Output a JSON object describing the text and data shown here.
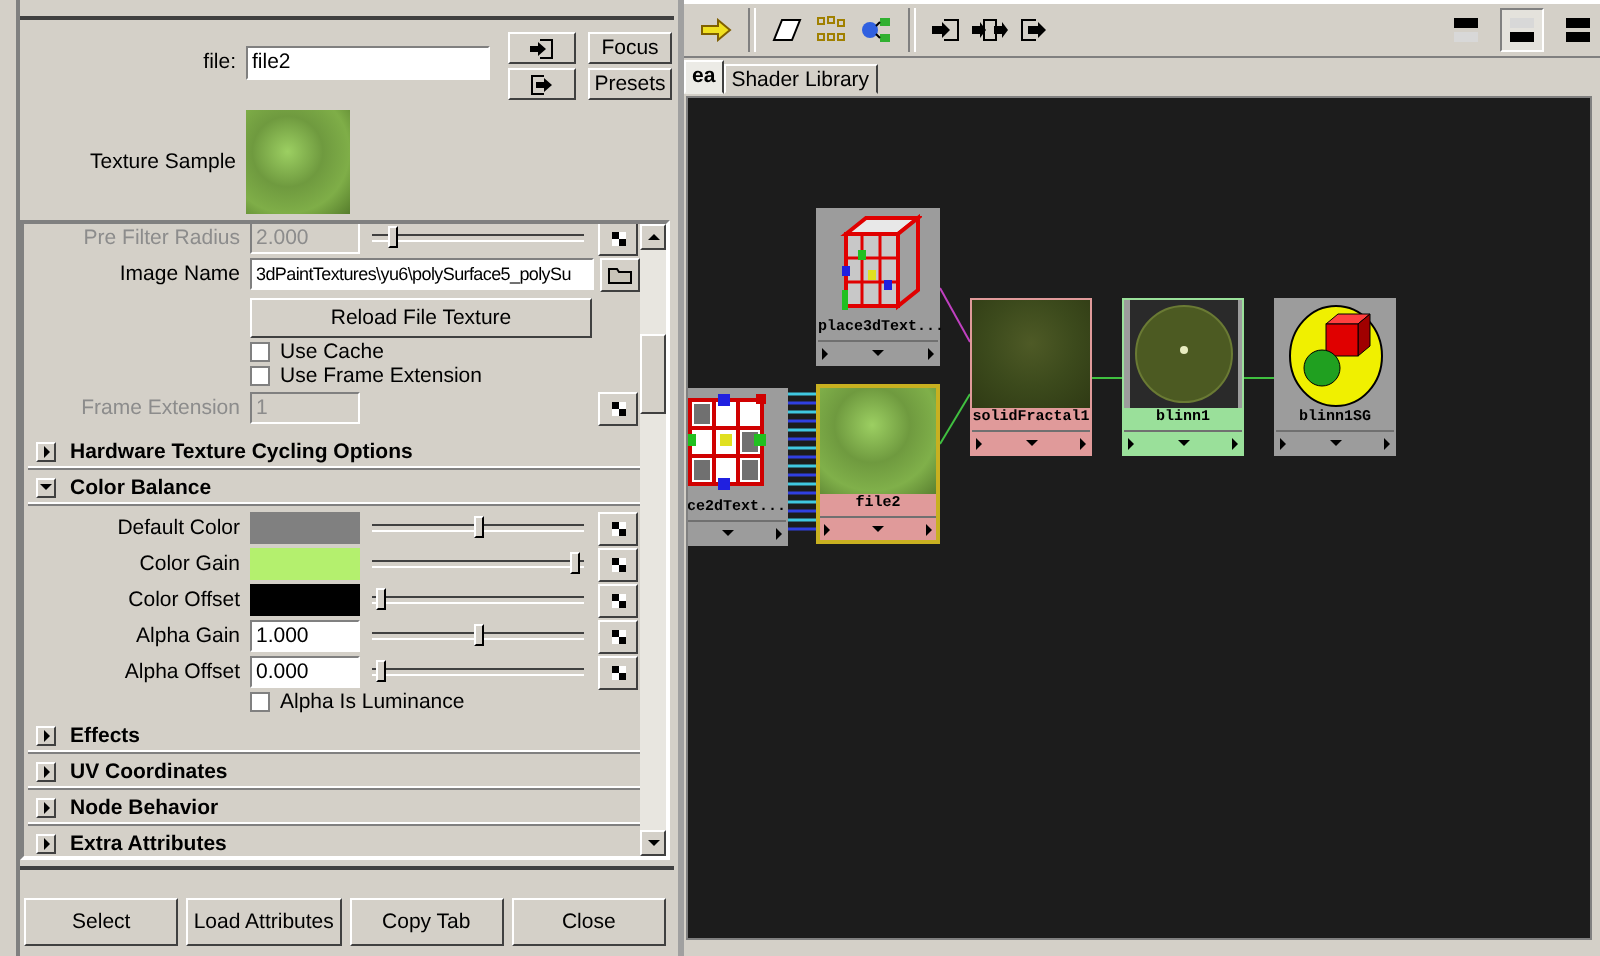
{
  "attribute_editor": {
    "file_label": "file:",
    "file_value": "file2",
    "text_buttons": [
      "Focus",
      "Presets"
    ],
    "texture_sample_label": "Texture Sample",
    "attributes": [
      {
        "kind": "slider",
        "label": "Pre Filter Radius",
        "value": "2.000",
        "level": 0.08,
        "disabled": true
      },
      {
        "kind": "path",
        "label": "Image Name",
        "value": "3dPaintTextures\\yu6\\polySurface5_polySu"
      },
      {
        "kind": "button",
        "label": "Reload File Texture"
      },
      {
        "kind": "checkbox",
        "label": "Use Cache",
        "checked": false
      },
      {
        "kind": "checkbox",
        "label": "Use Frame Extension",
        "checked": false
      },
      {
        "kind": "field",
        "label": "Frame Extension",
        "value": "1",
        "disabled": true
      }
    ],
    "sections": [
      {
        "title": "Hardware Texture Cycling Options",
        "expanded": false
      },
      {
        "title": "Color Balance",
        "expanded": true,
        "attributes": [
          {
            "kind": "color",
            "label": "Default Color",
            "color": "#808080",
            "level": 0.5
          },
          {
            "kind": "color",
            "label": "Color Gain",
            "color": "#b4f06e",
            "level": 0.98
          },
          {
            "kind": "color",
            "label": "Color Offset",
            "color": "#000000",
            "level": 0.02
          },
          {
            "kind": "number",
            "label": "Alpha Gain",
            "value": "1.000",
            "level": 0.5
          },
          {
            "kind": "number",
            "label": "Alpha Offset",
            "value": "0.000",
            "level": 0.02
          },
          {
            "kind": "checkbox",
            "label": "Alpha Is Luminance",
            "checked": false
          }
        ]
      },
      {
        "title": "Effects",
        "expanded": false
      },
      {
        "title": "UV Coordinates",
        "expanded": false
      },
      {
        "title": "Node Behavior",
        "expanded": false
      },
      {
        "title": "Extra Attributes",
        "expanded": false
      }
    ],
    "buttons": [
      "Select",
      "Load Attributes",
      "Copy Tab",
      "Close"
    ]
  },
  "hypershade": {
    "tabs": [
      {
        "label": "ea",
        "selected": true
      },
      {
        "label": "Shader Library",
        "selected": false
      }
    ],
    "layout_buttons": [
      {
        "selected": false
      },
      {
        "selected": true
      },
      {
        "selected": false
      }
    ],
    "nodes": [
      {
        "label": "place3dText...",
        "kind": "cube",
        "color": "#9c9c9c",
        "selected": false
      },
      {
        "label": "ce2dText...",
        "kind": "grid",
        "color": "#9c9c9c",
        "selected": false
      },
      {
        "label": "file2",
        "kind": "texture",
        "color": "#e09a9a",
        "selected": true
      },
      {
        "label": "solidFractal1",
        "kind": "fractal",
        "color": "#e09a9a",
        "selected": false
      },
      {
        "label": "blinn1",
        "kind": "sphere",
        "color": "#9ae09a",
        "selected": false
      },
      {
        "label": "blinn1SG",
        "kind": "shading_group",
        "color": "#9c9c9c",
        "selected": false
      }
    ]
  }
}
